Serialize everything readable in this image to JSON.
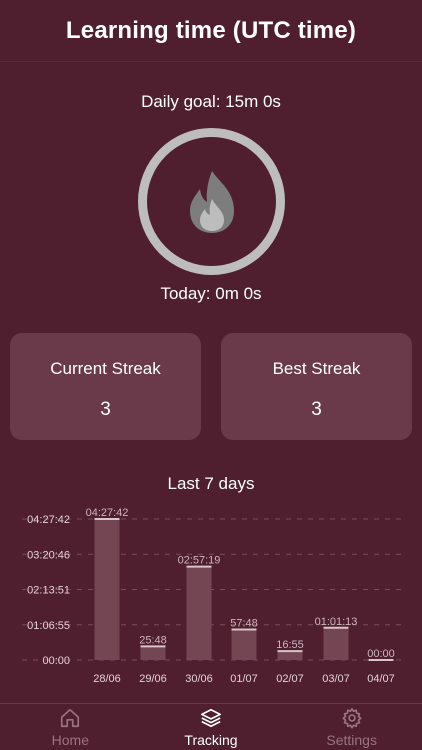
{
  "header": {
    "title": "Learning time (UTC time)"
  },
  "goal": {
    "text": "Daily goal: 15m 0s"
  },
  "today": {
    "text": "Today: 0m 0s"
  },
  "streaks": {
    "current": {
      "label": "Current Streak",
      "value": "3"
    },
    "best": {
      "label": "Best Streak",
      "value": "3"
    }
  },
  "chart_section": {
    "title": "Last 7 days"
  },
  "chart_data": {
    "type": "bar",
    "categories": [
      "28/06",
      "29/06",
      "30/06",
      "01/07",
      "02/07",
      "03/07",
      "04/07"
    ],
    "values": [
      16062,
      1548,
      10639,
      3468,
      1015,
      3673,
      0
    ],
    "value_labels": [
      "04:27:42",
      "25:48",
      "02:57:19",
      "57:48",
      "16:55",
      "01:01:13",
      "00:00"
    ],
    "yticks": [
      0,
      4015,
      8031,
      12046,
      16062
    ],
    "ytick_labels": [
      "00:00",
      "01:06:55",
      "02:13:51",
      "03:20:46",
      "04:27:42"
    ],
    "ylim": [
      0,
      16062
    ],
    "grid": true
  },
  "tabs": [
    {
      "label": "Home",
      "icon": "home-icon",
      "active": false
    },
    {
      "label": "Tracking",
      "icon": "layers-icon",
      "active": true
    },
    {
      "label": "Settings",
      "icon": "gear-icon",
      "active": false
    }
  ],
  "colors": {
    "background": "#4f1f2f",
    "card": "#6a3a4b",
    "bar": "#744654",
    "ring": "#bdbdbd"
  }
}
